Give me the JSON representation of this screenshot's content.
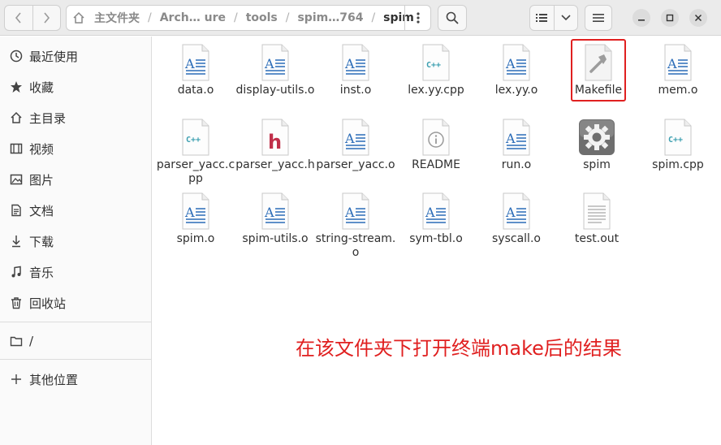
{
  "window": {
    "title": "spim"
  },
  "pathbar": {
    "segments": [
      "主文件夹",
      "Arch… ure",
      "tools",
      "spim…764",
      "spim"
    ]
  },
  "sidebar": {
    "items": [
      {
        "label": "最近使用",
        "icon": "clock-icon"
      },
      {
        "label": "收藏",
        "icon": "star-icon"
      },
      {
        "label": "主目录",
        "icon": "home-icon"
      },
      {
        "label": "视频",
        "icon": "film-icon"
      },
      {
        "label": "图片",
        "icon": "image-icon"
      },
      {
        "label": "文档",
        "icon": "document-icon"
      },
      {
        "label": "下载",
        "icon": "download-icon"
      },
      {
        "label": "音乐",
        "icon": "music-icon"
      },
      {
        "label": "回收站",
        "icon": "trash-icon"
      },
      {
        "label": "/",
        "icon": "folder-icon"
      },
      {
        "label": "其他位置",
        "icon": "plus-icon"
      }
    ]
  },
  "files": [
    {
      "name": "data.o",
      "type": "text"
    },
    {
      "name": "display-utils.o",
      "type": "text"
    },
    {
      "name": "inst.o",
      "type": "text"
    },
    {
      "name": "lex.yy.cpp",
      "type": "cpp"
    },
    {
      "name": "lex.yy.o",
      "type": "text"
    },
    {
      "name": "Makefile",
      "type": "makefile"
    },
    {
      "name": "mem.o",
      "type": "text"
    },
    {
      "name": "parser_yacc.cpp",
      "type": "cpp"
    },
    {
      "name": "parser_yacc.h",
      "type": "header"
    },
    {
      "name": "parser_yacc.o",
      "type": "text"
    },
    {
      "name": "README",
      "type": "readme"
    },
    {
      "name": "run.o",
      "type": "text"
    },
    {
      "name": "spim",
      "type": "executable"
    },
    {
      "name": "spim.cpp",
      "type": "cpp"
    },
    {
      "name": "spim.o",
      "type": "text"
    },
    {
      "name": "spim-utils.o",
      "type": "text"
    },
    {
      "name": "string-stream.o",
      "type": "text"
    },
    {
      "name": "sym-tbl.o",
      "type": "text"
    },
    {
      "name": "syscall.o",
      "type": "text"
    },
    {
      "name": "test.out",
      "type": "plain"
    }
  ],
  "annotation": "在该文件夹下打开终端make后的结果",
  "colors": {
    "annotation": "#e02020",
    "highlight": "#e02020",
    "text_icon": "#2b6cb8",
    "cpp_icon": "#3c9fb0",
    "header_icon": "#c0304a"
  }
}
